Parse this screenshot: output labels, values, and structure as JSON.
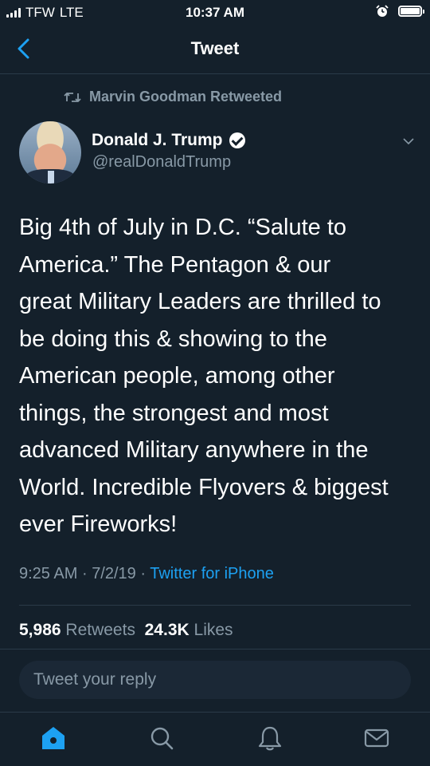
{
  "status_bar": {
    "carrier": "TFW",
    "network": "LTE",
    "time": "10:37 AM",
    "icons": [
      "signal-icon",
      "alarm-icon",
      "battery-icon"
    ]
  },
  "nav": {
    "title": "Tweet",
    "back_icon": "chevron-left-icon"
  },
  "retweet_banner": {
    "text": "Marvin Goodman Retweeted",
    "icon": "retweet-icon"
  },
  "tweet": {
    "author_name": "Donald J. Trump",
    "handle": "@realDonaldTrump",
    "verified": true,
    "text": "Big 4th of July in D.C. “Salute to\nAmerica.” The Pentagon & our\ngreat Military Leaders are thrilled to\nbe doing this & showing to the\nAmerican people, among other\nthings, the strongest and most\nadvanced Military anywhere in the\nWorld. Incredible Flyovers & biggest\never Fireworks!",
    "time": "9:25 AM",
    "date": "7/2/19",
    "separator": "·",
    "source": "Twitter for iPhone",
    "retweets_count": "5,986",
    "retweets_label": "Retweets",
    "likes_count": "24.3K",
    "likes_label": "Likes"
  },
  "reply": {
    "placeholder": "Tweet your reply"
  },
  "tabbar": {
    "items": [
      "home-icon",
      "search-icon",
      "notifications-icon",
      "messages-icon"
    ],
    "active": "home-icon"
  },
  "colors": {
    "background": "#14202b",
    "secondary_text": "#8899a6",
    "accent": "#1da1f2",
    "divider": "#2a3a48"
  }
}
